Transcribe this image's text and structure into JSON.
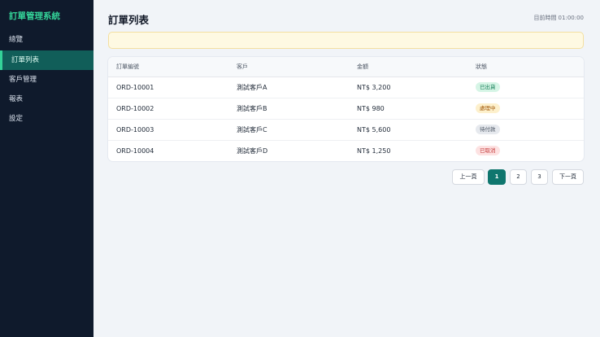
{
  "sidebar": {
    "brand": "訂單管理系統",
    "items": [
      {
        "label": "總覽"
      },
      {
        "label": "訂單列表"
      },
      {
        "label": "客戶管理"
      },
      {
        "label": "報表"
      },
      {
        "label": "設定"
      }
    ]
  },
  "header": {
    "title": "訂單列表",
    "clock_label": "目前時間",
    "clock_value": "01:00:00"
  },
  "alert": {
    "text": ""
  },
  "table": {
    "columns": [
      "訂單編號",
      "客戶",
      "金額",
      "狀態"
    ],
    "rows": [
      {
        "id": "ORD-10001",
        "customer": "測試客戶A",
        "amount": "NT$ 3,200",
        "status": "已出貨"
      },
      {
        "id": "ORD-10002",
        "customer": "測試客戶B",
        "amount": "NT$ 980",
        "status": "處理中"
      },
      {
        "id": "ORD-10003",
        "customer": "測試客戶C",
        "amount": "NT$ 5,600",
        "status": "待付款"
      },
      {
        "id": "ORD-10004",
        "customer": "測試客戶D",
        "amount": "NT$ 1,250",
        "status": "已取消"
      }
    ]
  },
  "pagination": {
    "prev": "上一頁",
    "pages": [
      "1",
      "2",
      "3"
    ],
    "current": "1",
    "next": "下一頁"
  },
  "colors": {
    "sidebar_bg": "#0f1a2c",
    "accent": "#0f766e",
    "brand": "#34d399",
    "alert_bg": "#fef9e2"
  }
}
